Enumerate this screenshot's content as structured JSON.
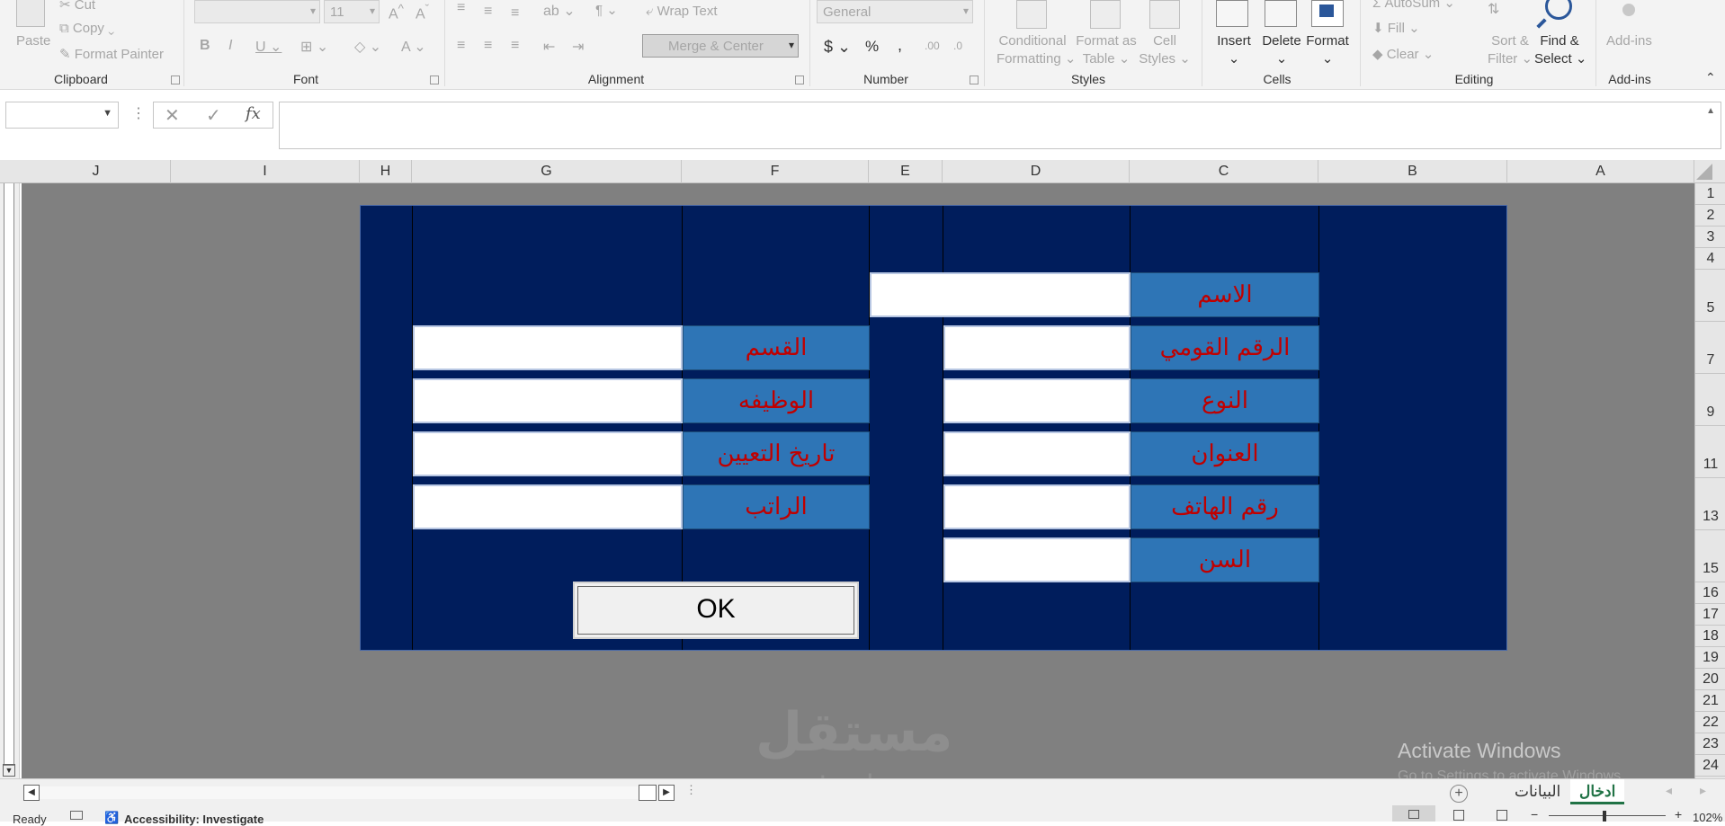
{
  "ribbon": {
    "clipboard": {
      "paste": "Paste",
      "cut": "Cut",
      "copy": "Copy",
      "format_painter": "Format Painter",
      "group": "Clipboard"
    },
    "font": {
      "name": "",
      "size": "11",
      "group": "Font"
    },
    "alignment": {
      "wrap_text": "Wrap Text",
      "merge_center": "Merge & Center",
      "group": "Alignment"
    },
    "number": {
      "format": "General",
      "group": "Number"
    },
    "styles": {
      "conditional_1": "Conditional",
      "conditional_2": "Formatting",
      "format_as_1": "Format as",
      "format_as_2": "Table",
      "cell_styles_1": "Cell",
      "cell_styles_2": "Styles",
      "group": "Styles"
    },
    "cells": {
      "insert": "Insert",
      "delete": "Delete",
      "format": "Format",
      "group": "Cells"
    },
    "editing": {
      "autosum": "AutoSum",
      "fill": "Fill",
      "clear": "Clear",
      "sort_1": "Sort &",
      "sort_2": "Filter",
      "find_1": "Find &",
      "find_2": "Select",
      "group": "Editing"
    },
    "addins": {
      "label": "Add-ins",
      "group": "Add-ins"
    }
  },
  "formula_bar": {
    "name_box": "",
    "formula": ""
  },
  "columns": [
    "J",
    "I",
    "H",
    "G",
    "F",
    "E",
    "D",
    "C",
    "B",
    "A"
  ],
  "rows": [
    "1",
    "2",
    "3",
    "4",
    "5",
    "7",
    "9",
    "11",
    "13",
    "15",
    "16",
    "17",
    "18",
    "19",
    "20",
    "21",
    "22",
    "23",
    "24"
  ],
  "form": {
    "name_label": "الاسم",
    "national_id_label": "الرقم القومي",
    "gender_label": "النوع",
    "address_label": "العنوان",
    "phone_label": "رقم الهاتف",
    "age_label": "السن",
    "department_label": "القسم",
    "job_label": "الوظيفه",
    "hire_date_label": "تاريخ التعيين",
    "salary_label": "الراتب",
    "ok_label": "OK",
    "colors": {
      "background": "#001d5c",
      "label_fill": "#2e75b6",
      "label_text": "#c00000"
    }
  },
  "sheets": {
    "tab_active": "ادخال",
    "tab_other": "البيانات"
  },
  "status": {
    "ready": "Ready",
    "accessibility": "Accessibility: Investigate",
    "zoom": "102%"
  },
  "watermark": {
    "logo_text": "مستقل",
    "site": "mostaql.com"
  },
  "activate": {
    "title": "Activate Windows",
    "subtitle": "Go to Settings to activate Windows."
  },
  "icons": [
    "scissors-icon",
    "copy-icon",
    "paintbrush-icon",
    "search-icon",
    "plus-icon",
    "sigma-icon"
  ]
}
